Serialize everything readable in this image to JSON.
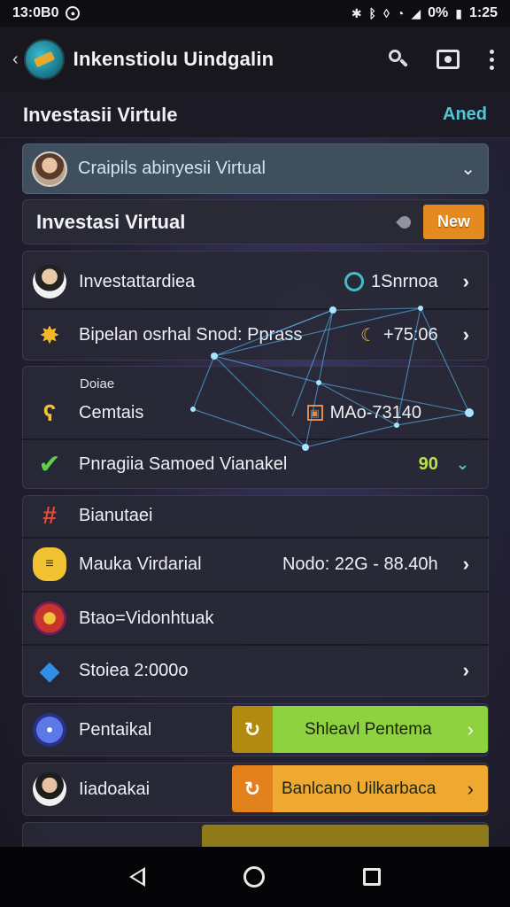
{
  "status_bar": {
    "time_left": "13:0B0",
    "battery": "0%",
    "time_right": "1:25"
  },
  "app_bar": {
    "title": "Inkenstiolu Uindgalin"
  },
  "page_header": {
    "title": "Investasii Virtule",
    "action": "Aned"
  },
  "selector": {
    "text": "Craipils abinyesii Virtual"
  },
  "section": {
    "title": "Investasi Virtual",
    "badge": "New"
  },
  "group1": [
    {
      "label": "Investattardiea",
      "meta": "1Snrnoa"
    },
    {
      "label": "Bipelan osrhal Snod: Pprass",
      "meta": "+75:06"
    }
  ],
  "group2": {
    "small_label": "Doiae",
    "rows": [
      {
        "label": "Cemtais",
        "meta": "MAo-73140"
      },
      {
        "label": "Pnragiia Samoed Vianakel",
        "meta": "90"
      }
    ]
  },
  "group3": [
    {
      "label": "Bianutaei",
      "meta": ""
    },
    {
      "label": "Mauka Virdarial",
      "meta": "Nodo: 22G - 88.40h"
    },
    {
      "label": "Btao=Vidonhtuak",
      "meta": ""
    },
    {
      "label": "Stoiea 2:000o",
      "meta": ""
    }
  ],
  "actions": [
    {
      "label": "Pentaikal",
      "button": "Shleavl Pentema",
      "color": "#8fd23f"
    },
    {
      "label": "Iiadoakai",
      "button": "Banlcano Uilkarbaca",
      "color": "#f0a930"
    }
  ]
}
